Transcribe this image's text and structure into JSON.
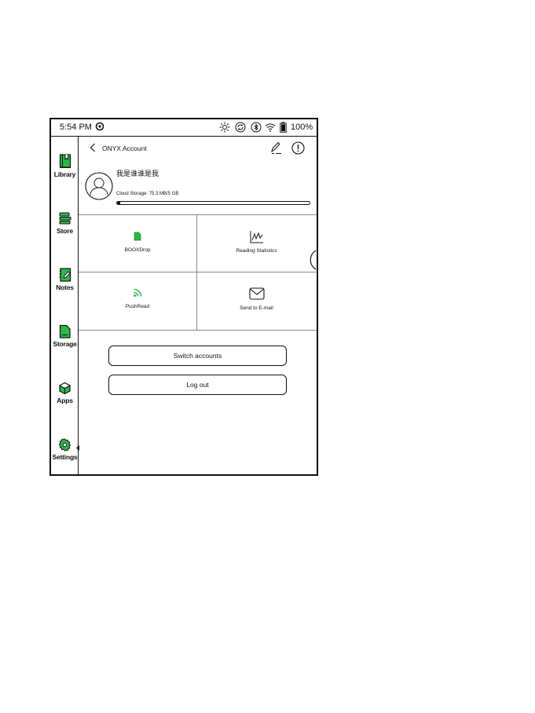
{
  "status_bar": {
    "time": "5:54 PM",
    "battery": "100%",
    "icons": [
      "sync-badge-icon",
      "brightness-icon",
      "refresh-icon",
      "bluetooth-icon",
      "wifi-icon",
      "battery-icon"
    ]
  },
  "sidebar": {
    "items": [
      {
        "label": "Library",
        "icon": "library-icon"
      },
      {
        "label": "Store",
        "icon": "store-icon"
      },
      {
        "label": "Notes",
        "icon": "notes-icon"
      },
      {
        "label": "Storage",
        "icon": "storage-icon"
      },
      {
        "label": "Apps",
        "icon": "apps-icon"
      },
      {
        "label": "Settings",
        "icon": "settings-icon",
        "active": true
      }
    ]
  },
  "header": {
    "title": "ONYX Account"
  },
  "profile": {
    "username": "我是谁谁是我",
    "storage_label": "Cloud Storage: 75.3 MB/5 GB",
    "storage_used_fraction": 0.015
  },
  "features": [
    {
      "label": "BOOXDrop",
      "icon": "booxdrop-icon"
    },
    {
      "label": "Reading Statistics",
      "icon": "statistics-icon"
    },
    {
      "label": "PushRead",
      "icon": "pushread-icon"
    },
    {
      "label": "Send to E-mail",
      "icon": "email-icon"
    }
  ],
  "buttons": {
    "switch_accounts": "Switch accounts",
    "log_out": "Log out"
  },
  "colors": {
    "accent_green": "#2db84a",
    "text": "#111111"
  }
}
